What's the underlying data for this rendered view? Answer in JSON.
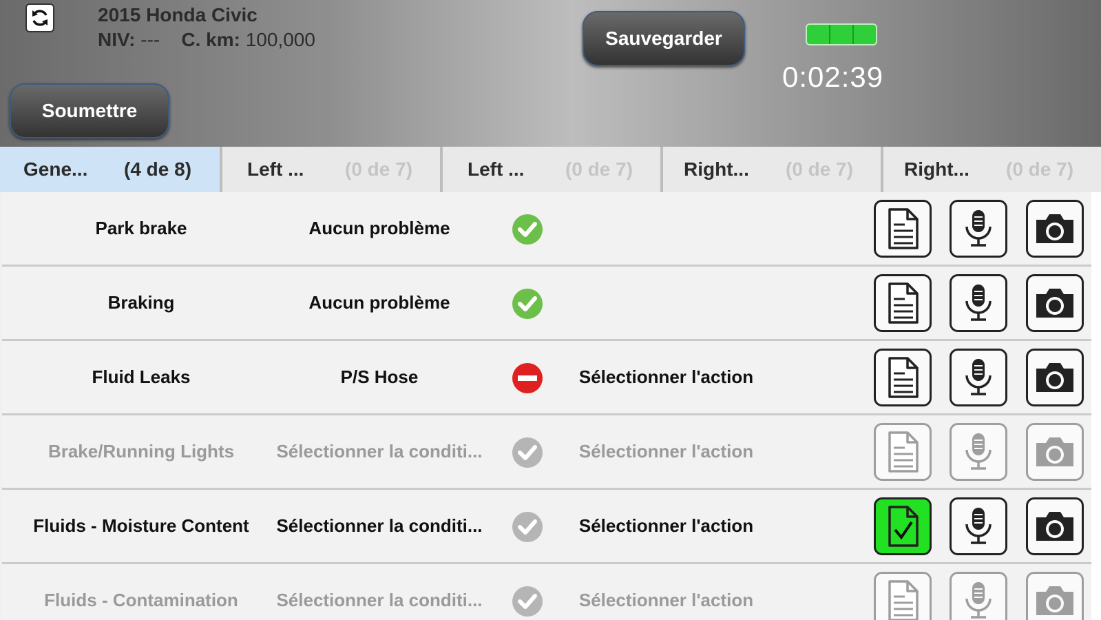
{
  "header": {
    "vehicle_title": "2015 Honda Civic",
    "vin_label": "NIV:",
    "vin_value": "---",
    "odo_label": "C. km:",
    "odo_value": "100,000",
    "save_label": "Sauvegarder",
    "submit_label": "Soumettre",
    "timer": "0:02:39",
    "battery_color": "#2fcf3a"
  },
  "tabs": [
    {
      "name": "Gene...",
      "count": "(4 de 8)"
    },
    {
      "name": "Left ...",
      "count": "(0 de 7)"
    },
    {
      "name": "Left ...",
      "count": "(0 de 7)"
    },
    {
      "name": "Right...",
      "count": "(0 de 7)"
    },
    {
      "name": "Right...",
      "count": "(0 de 7)"
    }
  ],
  "rows": [
    {
      "item": "Park brake",
      "condition": "Aucun problème",
      "status": "ok",
      "action": ""
    },
    {
      "item": "Braking",
      "condition": "Aucun problème",
      "status": "ok",
      "action": ""
    },
    {
      "item": "Fluid Leaks",
      "condition": "P/S Hose",
      "status": "problem",
      "action": "Sélectionner l'action"
    },
    {
      "item": "Brake/Running Lights",
      "condition": "Sélectionner la conditi...",
      "status": "unset",
      "action": "Sélectionner l'action"
    },
    {
      "item": "Fluids - Moisture Content",
      "condition": "Sélectionner la conditi...",
      "status": "unset",
      "action": "Sélectionner l'action"
    },
    {
      "item": "Fluids - Contamination",
      "condition": "Sélectionner la conditi...",
      "status": "unset",
      "action": "Sélectionner l'action"
    }
  ],
  "colors": {
    "ok": "#6cc04a",
    "problem": "#e02020",
    "unset": "#b5b5b5",
    "note_filled": "#22e022"
  }
}
